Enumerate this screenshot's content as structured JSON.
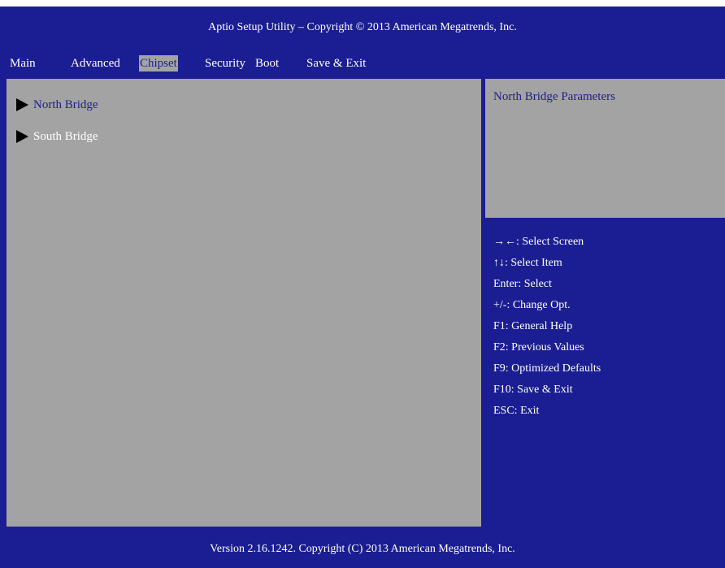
{
  "colors": {
    "background": "#1b1e92",
    "panel": "#a3a3a3",
    "highlight_text": "#1b1e92",
    "text": "#ffffff"
  },
  "title": "Aptio Setup Utility – Copyright © 2013 American Megatrends, Inc.",
  "tabs": [
    {
      "label": "Main"
    },
    {
      "label": "Advanced"
    },
    {
      "label": "Chipset",
      "active": true
    },
    {
      "label": "Security"
    },
    {
      "label": "Boot"
    },
    {
      "label": "Save & Exit"
    }
  ],
  "menu_items": [
    {
      "label": "North Bridge",
      "icon": "submenu-arrow-icon",
      "selected": true
    },
    {
      "label": "South Bridge",
      "icon": "submenu-arrow-icon",
      "selected": false
    }
  ],
  "help_text": "North Bridge Parameters",
  "key_help": [
    "→←: Select Screen",
    "↑↓: Select Item",
    "Enter: Select",
    "+/-: Change Opt.",
    "F1: General Help",
    "F2: Previous Values",
    "F9: Optimized Defaults",
    "F10: Save & Exit",
    "ESC: Exit"
  ],
  "footer": "Version 2.16.1242. Copyright (C) 2013 American Megatrends, Inc."
}
